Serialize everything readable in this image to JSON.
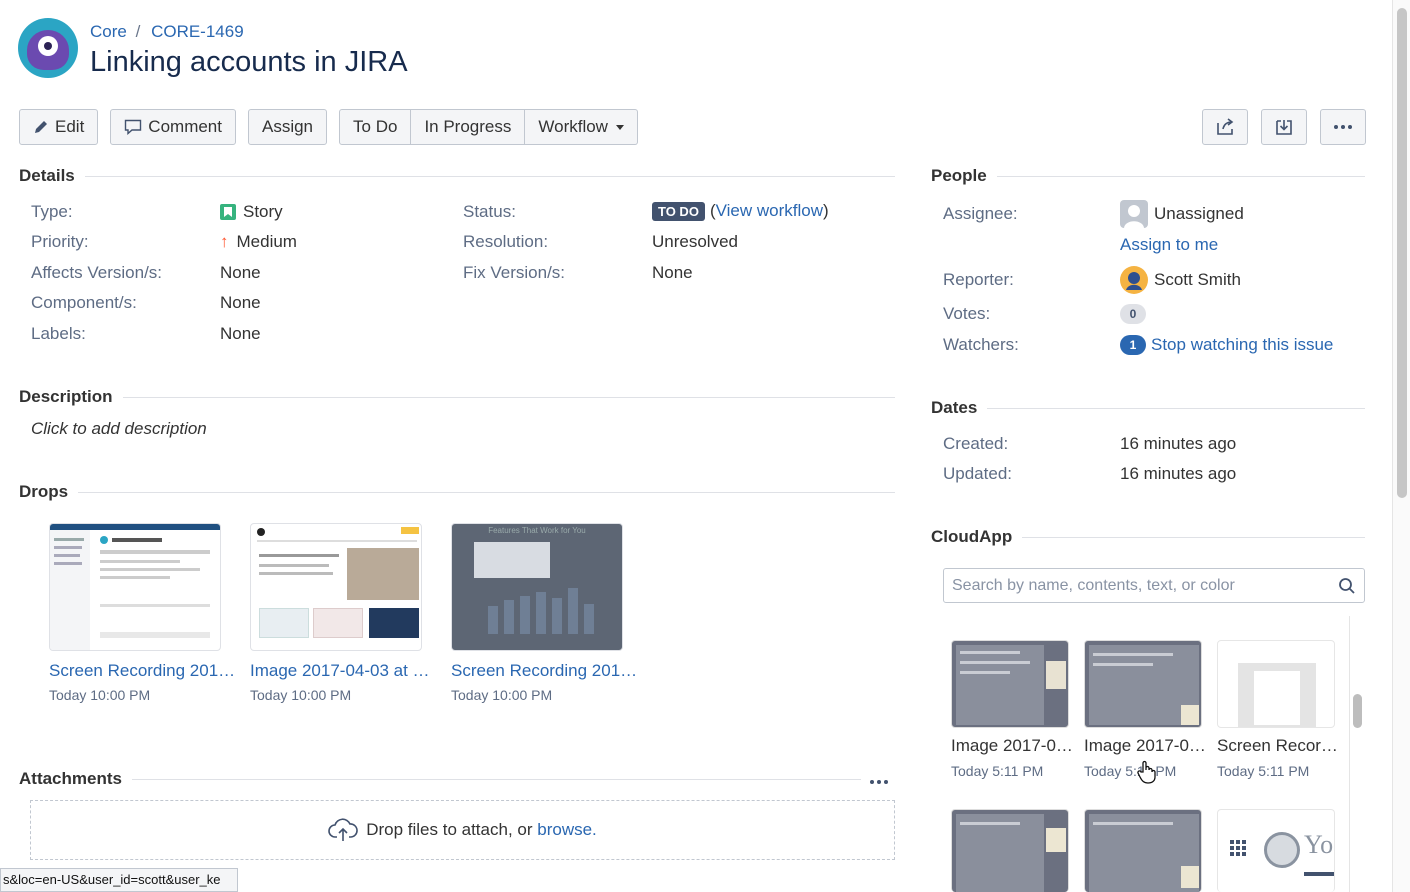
{
  "breadcrumb": {
    "project": "Core",
    "separator": "/",
    "issue_key": "CORE-1469"
  },
  "issue_title": "Linking accounts in JIRA",
  "toolbar": {
    "edit": "Edit",
    "comment": "Comment",
    "assign": "Assign",
    "todo": "To Do",
    "in_progress": "In Progress",
    "workflow": "Workflow"
  },
  "details": {
    "heading": "Details",
    "type_label": "Type:",
    "type_value": "Story",
    "priority_label": "Priority:",
    "priority_value": "Medium",
    "affects_label": "Affects Version/s:",
    "affects_value": "None",
    "components_label": "Component/s:",
    "components_value": "None",
    "labels_label": "Labels:",
    "labels_value": "None",
    "status_label": "Status:",
    "status_value": "TO DO",
    "view_workflow_open": "(",
    "view_workflow": "View workflow",
    "view_workflow_close": ")",
    "resolution_label": "Resolution:",
    "resolution_value": "Unresolved",
    "fix_label": "Fix Version/s:",
    "fix_value": "None"
  },
  "description": {
    "heading": "Description",
    "placeholder": "Click to add description"
  },
  "drops": {
    "heading": "Drops",
    "items": [
      {
        "name": "Screen Recording 201…",
        "time": "Today 10:00 PM"
      },
      {
        "name": "Image 2017-04-03 at …",
        "time": "Today 10:00 PM"
      },
      {
        "name": "Screen Recording 201…",
        "time": "Today 10:00 PM"
      }
    ],
    "thumb3_caption": "Features That Work for You"
  },
  "attachments": {
    "heading": "Attachments",
    "drop_text": "Drop files to attach, or ",
    "browse": "browse."
  },
  "people": {
    "heading": "People",
    "assignee_label": "Assignee:",
    "assignee_value": "Unassigned",
    "assign_to_me": "Assign to me",
    "reporter_label": "Reporter:",
    "reporter_value": "Scott Smith",
    "votes_label": "Votes:",
    "votes_count": "0",
    "watchers_label": "Watchers:",
    "watchers_count": "1",
    "stop_watching": "Stop watching this issue"
  },
  "dates": {
    "heading": "Dates",
    "created_label": "Created:",
    "created_value": "16 minutes ago",
    "updated_label": "Updated:",
    "updated_value": "16 minutes ago"
  },
  "cloudapp": {
    "heading": "CloudApp",
    "search_placeholder": "Search by name, contents, text, or color",
    "items": [
      {
        "name": "Image 2017-0…",
        "time": "Today 5:11 PM"
      },
      {
        "name": "Image 2017-0…",
        "time": "Today 5:11 PM"
      },
      {
        "name": "Screen Recor…",
        "time": "Today 5:11 PM"
      }
    ],
    "partial_logo_text": "Yo"
  },
  "status_bar_url": "s&loc=en-US&user_id=scott&user_ke",
  "icons": [
    "edit-icon",
    "comment-icon",
    "share-icon",
    "export-icon",
    "more-icon",
    "search-icon",
    "upload-cloud-icon",
    "story-icon",
    "priority-arrow-icon",
    "avatar-icon",
    "film-icon",
    "grid-icon",
    "hand-cursor-icon"
  ],
  "colors": {
    "link": "#2a67b1",
    "status_lozenge": "#42526e",
    "story": "#36b37e",
    "priority": "#ff5630"
  }
}
